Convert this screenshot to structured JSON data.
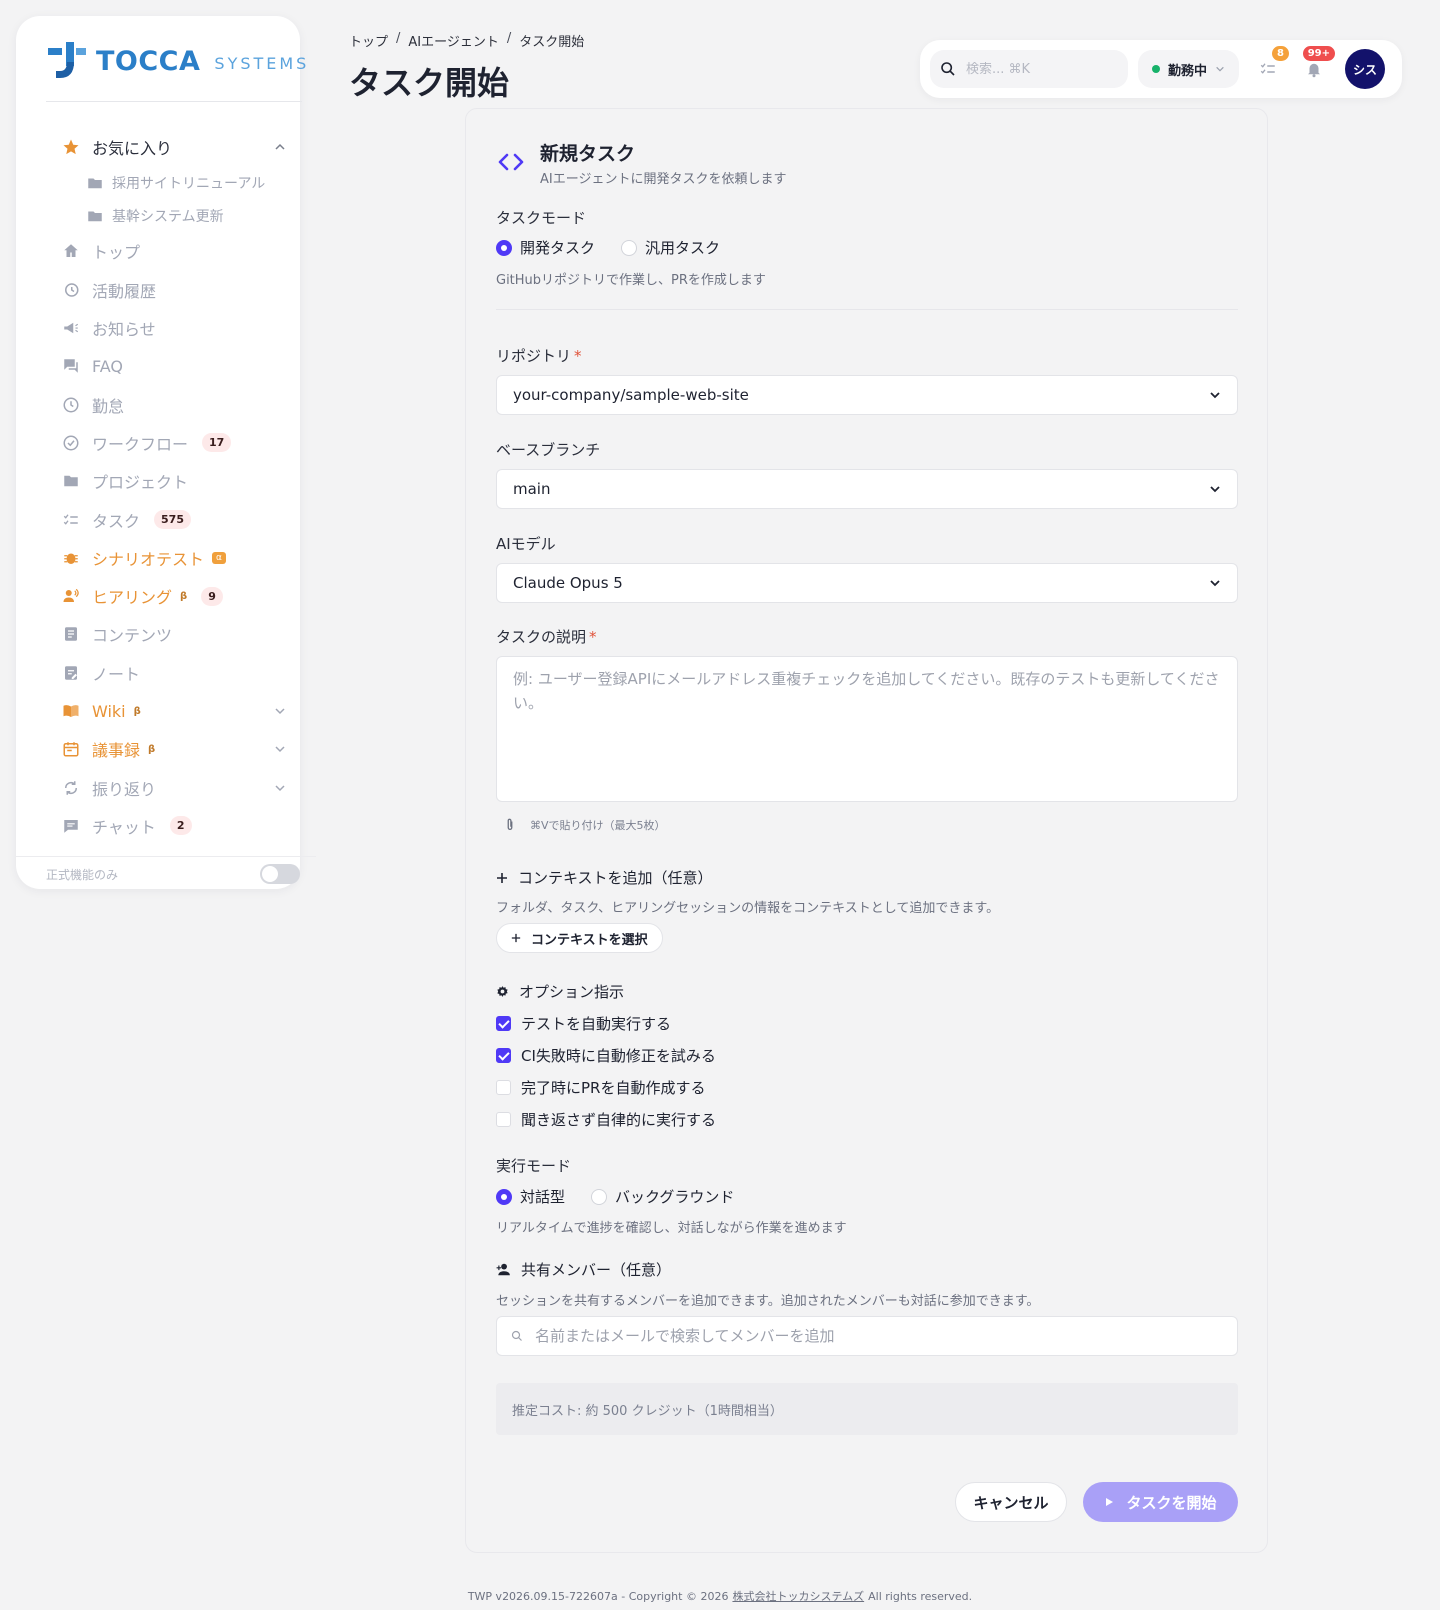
{
  "brand": {
    "name": "TOCCA",
    "sub": "SYSTEMS"
  },
  "sidebar": {
    "favorites_label": "お気に入り",
    "favorites": [
      "採用サイトリニューアル",
      "基幹システム更新"
    ],
    "items": [
      {
        "label": "トップ",
        "icon": "home-icon"
      },
      {
        "label": "活動履歴",
        "icon": "history-icon"
      },
      {
        "label": "お知らせ",
        "icon": "megaphone-icon"
      },
      {
        "label": "FAQ",
        "icon": "faq-icon"
      },
      {
        "label": "勤怠",
        "icon": "clock-icon"
      },
      {
        "label": "ワークフロー",
        "icon": "check-circle-icon",
        "badge": "17"
      },
      {
        "label": "プロジェクト",
        "icon": "folder-icon"
      },
      {
        "label": "タスク",
        "icon": "checklist-icon",
        "badge": "575"
      },
      {
        "label": "シナリオテスト",
        "icon": "bug-icon",
        "tag": "α"
      },
      {
        "label": "ヒアリング",
        "icon": "voice-icon",
        "beta": "β",
        "badge": "9"
      },
      {
        "label": "コンテンツ",
        "icon": "document-icon"
      },
      {
        "label": "ノート",
        "icon": "note-icon"
      },
      {
        "label": "Wiki",
        "icon": "book-icon",
        "beta": "β"
      },
      {
        "label": "議事録",
        "icon": "calendar-icon",
        "beta": "β"
      },
      {
        "label": "振り返り",
        "icon": "refresh-icon"
      },
      {
        "label": "チャット",
        "icon": "chat-icon",
        "badge": "2"
      }
    ],
    "footer_label": "正式機能のみ"
  },
  "breadcrumb": [
    "トップ",
    "AIエージェント",
    "タスク開始"
  ],
  "breadcrumb_sep": "/",
  "page_title": "タスク開始",
  "topbar": {
    "search_placeholder": "検索... ⌘K",
    "status": "勤務中",
    "task_badge": "8",
    "notif_badge": "99+",
    "avatar": "シス"
  },
  "form": {
    "title": "新規タスク",
    "subtitle": "AIエージェントに開発タスクを依頼します",
    "mode_label": "タスクモード",
    "mode_options": [
      "開発タスク",
      "汎用タスク"
    ],
    "mode_hint": "GitHubリポジトリで作業し、PRを作成します",
    "repo_label": "リポジトリ",
    "repo_value": "your-company/sample-web-site",
    "branch_label": "ベースブランチ",
    "branch_value": "main",
    "model_label": "AIモデル",
    "model_value": "Claude Opus 5",
    "desc_label": "タスクの説明",
    "desc_placeholder": "例: ユーザー登録APIにメールアドレス重複チェックを追加してください。既存のテストも更新してください。",
    "paste_hint": "⌘Vで貼り付け（最大5枚）",
    "context_title": "コンテキストを追加（任意）",
    "context_hint": "フォルダ、タスク、ヒアリングセッションの情報をコンテキストとして追加できます。",
    "context_button": "コンテキストを選択",
    "options_title": "オプション指示",
    "options": [
      {
        "label": "テストを自動実行する",
        "checked": true
      },
      {
        "label": "CI失敗時に自動修正を試みる",
        "checked": true
      },
      {
        "label": "完了時にPRを自動作成する",
        "checked": false
      },
      {
        "label": "聞き返さず自律的に実行する",
        "checked": false
      }
    ],
    "exec_label": "実行モード",
    "exec_options": [
      "対話型",
      "バックグラウンド"
    ],
    "exec_hint": "リアルタイムで進捗を確認し、対話しながら作業を進めます",
    "members_title": "共有メンバー（任意）",
    "members_hint": "セッションを共有するメンバーを追加できます。追加されたメンバーも対話に参加できます。",
    "members_placeholder": "名前またはメールで検索してメンバーを追加",
    "cost": "推定コスト: 約 500 クレジット（1時間相当）",
    "cancel": "キャンセル",
    "start": "タスクを開始"
  },
  "footer": {
    "prefix": "TWP v2026.09.15-722607a - Copyright © 2026",
    "company": "株式会社トッカシステムズ",
    "suffix": "All rights reserved."
  },
  "colors": {
    "accent": "#4f39f6",
    "brand": "#2b7fc8",
    "orange": "#e89336"
  }
}
